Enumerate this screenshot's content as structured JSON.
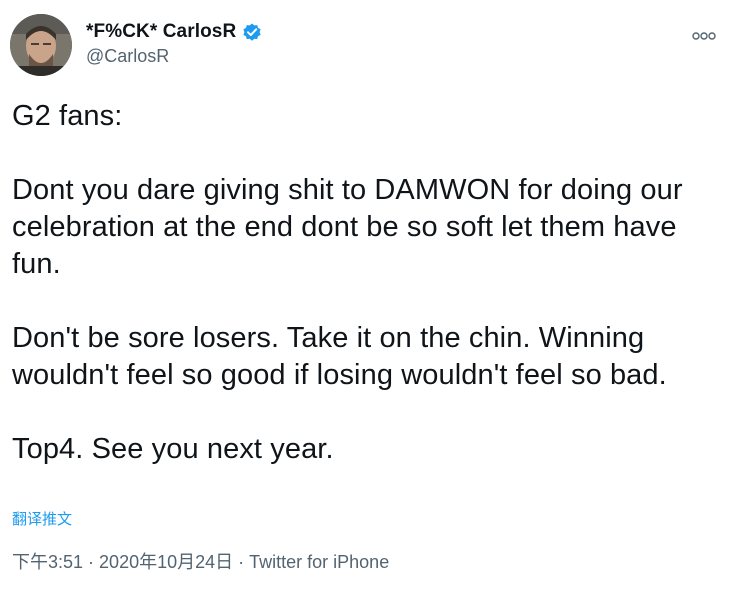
{
  "author": {
    "display_name": "*F%CK* CarlosR",
    "handle": "@CarlosR",
    "verified_icon": "verified-badge-icon",
    "avatar_icon": "avatar"
  },
  "more_icon": "more-options-icon",
  "tweet": {
    "paragraphs": [
      "G2 fans:",
      "Dont you dare giving shit to DAMWON for doing our celebration at the end dont be so soft let them have fun.",
      "Don't be sore losers. Take it on the chin. Winning wouldn't feel so good if losing wouldn't feel so bad.",
      "Top4. See you next year."
    ],
    "translate_label": "翻译推文"
  },
  "meta": {
    "time": "下午3:51",
    "separator": "·",
    "date": "2020年10月24日",
    "source": "Twitter for iPhone"
  },
  "colors": {
    "accent": "#1d9bf0",
    "text": "#0f1419",
    "muted": "#536471"
  }
}
